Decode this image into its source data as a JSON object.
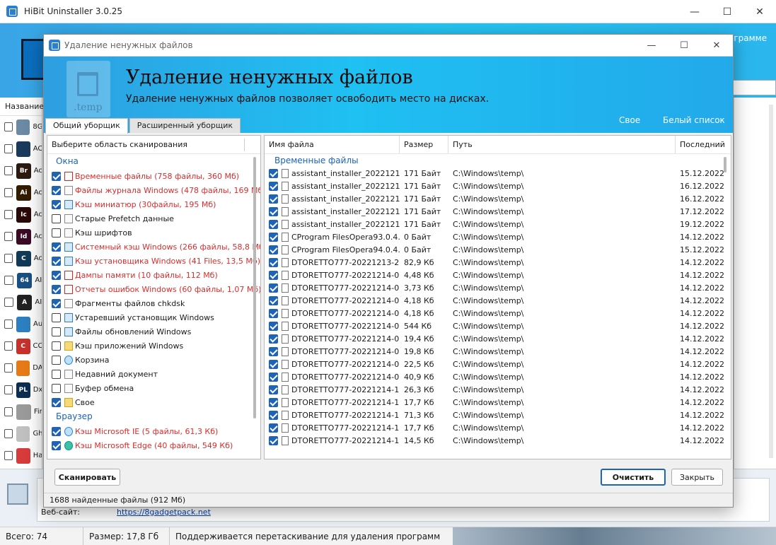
{
  "main": {
    "title": "HiBit Uninstaller 3.0.25",
    "header_right_text": "ограмме",
    "list_header": "Название",
    "apps": [
      {
        "name": "8G",
        "color": "#6c8aa5",
        "icon": "app-icon",
        "badge": ""
      },
      {
        "name": "AC",
        "color": "#1a3a5c",
        "icon": "app-icon",
        "badge": ""
      },
      {
        "name": "Ac",
        "color": "#2c1a10",
        "icon": "bridge-icon",
        "badge": "Br"
      },
      {
        "name": "Ac",
        "color": "#331b00",
        "icon": "illustrator-icon",
        "badge": "Ai"
      },
      {
        "name": "Ac",
        "color": "#2a0808",
        "icon": "incopy-icon",
        "badge": "Ic"
      },
      {
        "name": "Ac",
        "color": "#3b0a24",
        "icon": "indesign-icon",
        "badge": "Id"
      },
      {
        "name": "Ac",
        "color": "#123a58",
        "icon": "app-icon",
        "badge": "C"
      },
      {
        "name": "AI",
        "color": "#1a4f82",
        "icon": "aida64-icon",
        "badge": "64"
      },
      {
        "name": "AI",
        "color": "#222222",
        "icon": "app-icon",
        "badge": "A"
      },
      {
        "name": "Au",
        "color": "#2d7fc1",
        "icon": "app-icon",
        "badge": ""
      },
      {
        "name": "CC",
        "color": "#c9302c",
        "icon": "ccleaner-icon",
        "badge": "C"
      },
      {
        "name": "DA",
        "color": "#e67a16",
        "icon": "app-icon",
        "badge": ""
      },
      {
        "name": "Dx",
        "color": "#0a2e52",
        "icon": "app-icon",
        "badge": "PL"
      },
      {
        "name": "Fir",
        "color": "#9a9a9a",
        "icon": "app-icon",
        "badge": ""
      },
      {
        "name": "Gh",
        "color": "#c0c0c0",
        "icon": "disc-icon",
        "badge": ""
      },
      {
        "name": "Ha",
        "color": "#d83b3b",
        "icon": "app-icon",
        "badge": ""
      }
    ],
    "website_label": "Веб-сайт:",
    "website_link": "https://8gadgetpack.net",
    "status": {
      "total": "Всего: 74",
      "size": "Размер: 17,8 Гб",
      "hint": "Поддерживается перетаскивание для удаления программ"
    }
  },
  "dialog": {
    "title": "Удаление ненужных файлов",
    "heading": "Удаление ненужных файлов",
    "subheading": "Удаление ненужных файлов позволяет освободить место на дисках.",
    "link_custom": "Свое",
    "link_whitelist": "Белый список",
    "banner_icon_text": ".temp",
    "tabs": [
      "Общий уборщик",
      "Расширенный уборщик"
    ],
    "left": {
      "header": "Выберите область сканирования",
      "groups": [
        {
          "name": "Окна",
          "items": [
            {
              "label": "Временные файлы (758 файлы, 360 Мб)",
              "checked": true,
              "red": true,
              "icon": "temp-files-icon",
              "ico": "red"
            },
            {
              "label": "Файлы журнала Windows (478 файлы, 169 Мб)",
              "checked": true,
              "red": true,
              "icon": "log-file-icon",
              "ico": ""
            },
            {
              "label": "Кэш миниатюр (30файлы, 195 Мб)",
              "checked": true,
              "red": true,
              "icon": "thumbnail-icon",
              "ico": "blue"
            },
            {
              "label": "Старые Prefetch данные",
              "checked": false,
              "red": false,
              "icon": "document-icon",
              "ico": ""
            },
            {
              "label": "Кэш шрифтов",
              "checked": false,
              "red": false,
              "icon": "font-icon",
              "ico": ""
            },
            {
              "label": "Системный кэш Windows (266 файлы, 58,8 Мб)",
              "checked": true,
              "red": true,
              "icon": "system-cache-icon",
              "ico": "blue"
            },
            {
              "label": "Кэш установщика Windows (41 Files, 13,5 Мб)",
              "checked": true,
              "red": true,
              "icon": "installer-icon",
              "ico": "blue"
            },
            {
              "label": "Дампы памяти (10 файлы, 112 Мб)",
              "checked": true,
              "red": true,
              "icon": "memory-dump-icon",
              "ico": "red"
            },
            {
              "label": "Отчеты ошибок Windows (60 файлы, 1,07 Мб)",
              "checked": true,
              "red": true,
              "icon": "error-report-icon",
              "ico": "red"
            },
            {
              "label": "Фрагменты файлов chkdsk",
              "checked": true,
              "red": false,
              "icon": "chkdsk-icon",
              "ico": ""
            },
            {
              "label": "Устаревший установщик Windows",
              "checked": false,
              "red": false,
              "icon": "installer-icon",
              "ico": "blue"
            },
            {
              "label": "Файлы обновлений Windows",
              "checked": false,
              "red": false,
              "icon": "update-icon",
              "ico": "blue"
            },
            {
              "label": "Кэш приложений Windows",
              "checked": false,
              "red": false,
              "icon": "app-cache-icon",
              "ico": "gold"
            },
            {
              "label": "Корзина",
              "checked": false,
              "red": false,
              "icon": "recycle-bin-icon",
              "ico": "round"
            },
            {
              "label": "Недавний документ",
              "checked": false,
              "red": false,
              "icon": "document-icon",
              "ico": ""
            },
            {
              "label": "Буфер обмена",
              "checked": false,
              "red": false,
              "icon": "clipboard-icon",
              "ico": ""
            },
            {
              "label": "Свое",
              "checked": true,
              "red": false,
              "icon": "folder-icon",
              "ico": "gold"
            }
          ]
        },
        {
          "name": "Браузер",
          "items": [
            {
              "label": "Кэш Microsoft IE (5 файлы, 61,3 Кб)",
              "checked": true,
              "red": true,
              "icon": "ie-icon",
              "ico": "round"
            },
            {
              "label": "Кэш Microsoft Edge (40 файлы, 549 Кб)",
              "checked": true,
              "red": true,
              "icon": "edge-icon",
              "ico": "edge"
            }
          ]
        }
      ]
    },
    "right": {
      "columns": [
        "Имя файла",
        "Размер",
        "Путь",
        "Последний"
      ],
      "group": "Временные файлы",
      "rows": [
        {
          "name": "assistant_installer_2022121...",
          "size": "171 Байт",
          "path": "C:\\Windows\\temp\\",
          "date": "15.12.2022"
        },
        {
          "name": "assistant_installer_2022121...",
          "size": "171 Байт",
          "path": "C:\\Windows\\temp\\",
          "date": "16.12.2022"
        },
        {
          "name": "assistant_installer_2022121...",
          "size": "171 Байт",
          "path": "C:\\Windows\\temp\\",
          "date": "16.12.2022"
        },
        {
          "name": "assistant_installer_2022121...",
          "size": "171 Байт",
          "path": "C:\\Windows\\temp\\",
          "date": "17.12.2022"
        },
        {
          "name": "assistant_installer_2022121...",
          "size": "171 Байт",
          "path": "C:\\Windows\\temp\\",
          "date": "19.12.2022"
        },
        {
          "name": "CProgram FilesOpera93.0.4...",
          "size": "0 Байт",
          "path": "C:\\Windows\\temp\\",
          "date": "14.12.2022"
        },
        {
          "name": "CProgram FilesOpera94.0.4...",
          "size": "0 Байт",
          "path": "C:\\Windows\\temp\\",
          "date": "15.12.2022"
        },
        {
          "name": "DTORETTO777-20221213-2...",
          "size": "82,9 Кб",
          "path": "C:\\Windows\\temp\\",
          "date": "14.12.2022"
        },
        {
          "name": "DTORETTO777-20221214-0...",
          "size": "4,48 Кб",
          "path": "C:\\Windows\\temp\\",
          "date": "14.12.2022"
        },
        {
          "name": "DTORETTO777-20221214-0...",
          "size": "3,73 Кб",
          "path": "C:\\Windows\\temp\\",
          "date": "14.12.2022"
        },
        {
          "name": "DTORETTO777-20221214-0...",
          "size": "4,18 Кб",
          "path": "C:\\Windows\\temp\\",
          "date": "14.12.2022"
        },
        {
          "name": "DTORETTO777-20221214-0...",
          "size": "4,18 Кб",
          "path": "C:\\Windows\\temp\\",
          "date": "14.12.2022"
        },
        {
          "name": "DTORETTO777-20221214-0...",
          "size": "544 Кб",
          "path": "C:\\Windows\\temp\\",
          "date": "14.12.2022"
        },
        {
          "name": "DTORETTO777-20221214-0...",
          "size": "19,4 Кб",
          "path": "C:\\Windows\\temp\\",
          "date": "14.12.2022"
        },
        {
          "name": "DTORETTO777-20221214-0...",
          "size": "19,8 Кб",
          "path": "C:\\Windows\\temp\\",
          "date": "14.12.2022"
        },
        {
          "name": "DTORETTO777-20221214-0...",
          "size": "22,5 Кб",
          "path": "C:\\Windows\\temp\\",
          "date": "14.12.2022"
        },
        {
          "name": "DTORETTO777-20221214-0...",
          "size": "40,9 Кб",
          "path": "C:\\Windows\\temp\\",
          "date": "14.12.2022"
        },
        {
          "name": "DTORETTO777-20221214-1...",
          "size": "26,3 Кб",
          "path": "C:\\Windows\\temp\\",
          "date": "14.12.2022"
        },
        {
          "name": "DTORETTO777-20221214-1...",
          "size": "17,7 Кб",
          "path": "C:\\Windows\\temp\\",
          "date": "14.12.2022"
        },
        {
          "name": "DTORETTO777-20221214-1...",
          "size": "71,3 Кб",
          "path": "C:\\Windows\\temp\\",
          "date": "14.12.2022"
        },
        {
          "name": "DTORETTO777-20221214-1...",
          "size": "17,7 Кб",
          "path": "C:\\Windows\\temp\\",
          "date": "14.12.2022"
        },
        {
          "name": "DTORETTO777-20221214-1...",
          "size": "14,5 Кб",
          "path": "C:\\Windows\\temp\\",
          "date": "14.12.2022"
        }
      ]
    },
    "buttons": {
      "scan": "Сканировать",
      "clean": "Очистить",
      "close": "Закрыть"
    },
    "found": "1688  найденные файлы (912 Мб)"
  }
}
